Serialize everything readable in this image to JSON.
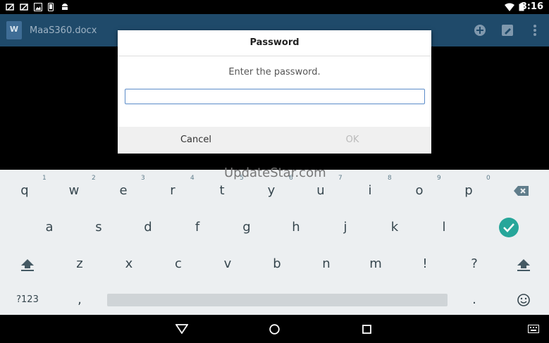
{
  "status_bar": {
    "time": "8:16",
    "icons_left": [
      "missed-call-icon",
      "missed-call-icon",
      "image-icon",
      "phone-icon",
      "android-icon"
    ],
    "icons_right": [
      "wifi-icon",
      "battery-icon"
    ]
  },
  "app_bar": {
    "document_title": "MaaS360.docx",
    "doc_icon_letter": "W",
    "actions": [
      "add-icon",
      "edit-icon",
      "more-vert-icon"
    ],
    "color": "#1f4a6a"
  },
  "dialog": {
    "title": "Password",
    "message": "Enter the password.",
    "input_value": "",
    "cancel_label": "Cancel",
    "ok_label": "OK"
  },
  "keyboard": {
    "watermark": "UpdateStar.com",
    "row1": [
      {
        "key": "q",
        "hint": "1"
      },
      {
        "key": "w",
        "hint": "2"
      },
      {
        "key": "e",
        "hint": "3"
      },
      {
        "key": "r",
        "hint": "4"
      },
      {
        "key": "t",
        "hint": "5"
      },
      {
        "key": "y",
        "hint": "6"
      },
      {
        "key": "u",
        "hint": "7"
      },
      {
        "key": "i",
        "hint": "8"
      },
      {
        "key": "o",
        "hint": "9"
      },
      {
        "key": "p",
        "hint": "0"
      }
    ],
    "row2": [
      "a",
      "s",
      "d",
      "f",
      "g",
      "h",
      "j",
      "k",
      "l"
    ],
    "row3": [
      "z",
      "x",
      "c",
      "v",
      "b",
      "n",
      "m",
      "!",
      "?"
    ],
    "symbols_label": "?123",
    "comma": ",",
    "period": ".",
    "accent": "#26a69a"
  },
  "nav_bar": {
    "buttons": [
      "back-icon",
      "home-icon",
      "recents-icon",
      "keyboard-switch-icon"
    ]
  }
}
